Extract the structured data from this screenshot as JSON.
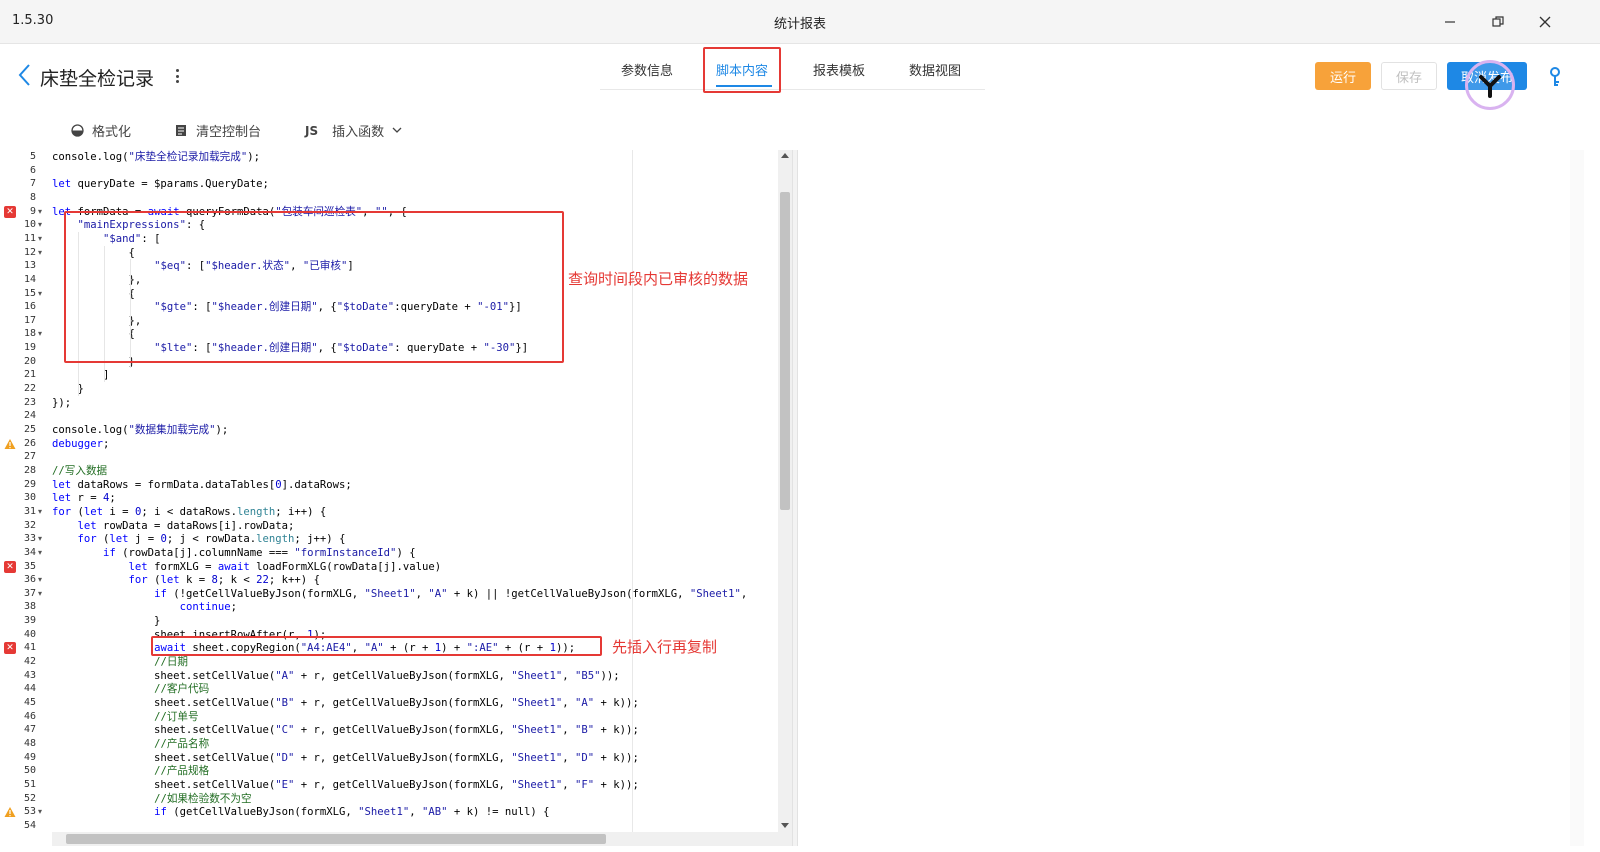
{
  "window": {
    "version": "1.5.30",
    "title": "统计报表"
  },
  "header": {
    "page_title": "床垫全检记录",
    "tabs": [
      {
        "label": "参数信息",
        "active": false
      },
      {
        "label": "脚本内容",
        "active": true
      },
      {
        "label": "报表模板",
        "active": false
      },
      {
        "label": "数据视图",
        "active": false
      }
    ],
    "buttons": {
      "run": "运行",
      "save": "保存",
      "publish": "取消发布"
    }
  },
  "toolbar": {
    "format": "格式化",
    "clear_console": "清空控制台",
    "js_badge": "JS",
    "insert_function": "插入函数"
  },
  "editor": {
    "lines": [
      {
        "n": 5,
        "text": "console.log(\"床垫全检记录加载完成\");"
      },
      {
        "n": 6,
        "text": ""
      },
      {
        "n": 7,
        "text": "let queryDate = $params.QueryDate;"
      },
      {
        "n": 8,
        "text": ""
      },
      {
        "n": 9,
        "text": "let formData = await queryFormData(\"包装车间巡检表\", \"\", {",
        "marker": "error",
        "fold": true
      },
      {
        "n": 10,
        "text": "    \"mainExpressions\": {",
        "fold": true
      },
      {
        "n": 11,
        "text": "        \"$and\": [",
        "fold": true
      },
      {
        "n": 12,
        "text": "            {",
        "fold": true
      },
      {
        "n": 13,
        "text": "                \"$eq\": [\"$header.状态\", \"已审核\"]"
      },
      {
        "n": 14,
        "text": "            },"
      },
      {
        "n": 15,
        "text": "            {",
        "fold": true
      },
      {
        "n": 16,
        "text": "                \"$gte\": [\"$header.创建日期\", {\"$toDate\":queryDate + \"-01\"}]"
      },
      {
        "n": 17,
        "text": "            },"
      },
      {
        "n": 18,
        "text": "            {",
        "fold": true
      },
      {
        "n": 19,
        "text": "                \"$lte\": [\"$header.创建日期\", {\"$toDate\": queryDate + \"-30\"}]"
      },
      {
        "n": 20,
        "text": "            }"
      },
      {
        "n": 21,
        "text": "        ]"
      },
      {
        "n": 22,
        "text": "    }"
      },
      {
        "n": 23,
        "text": "});"
      },
      {
        "n": 24,
        "text": ""
      },
      {
        "n": 25,
        "text": "console.log(\"数据集加载完成\");"
      },
      {
        "n": 26,
        "text": "debugger;",
        "marker": "warning"
      },
      {
        "n": 27,
        "text": ""
      },
      {
        "n": 28,
        "text": "//写入数据"
      },
      {
        "n": 29,
        "text": "let dataRows = formData.dataTables[0].dataRows;"
      },
      {
        "n": 30,
        "text": "let r = 4;"
      },
      {
        "n": 31,
        "text": "for (let i = 0; i < dataRows.length; i++) {",
        "fold": true
      },
      {
        "n": 32,
        "text": "    let rowData = dataRows[i].rowData;"
      },
      {
        "n": 33,
        "text": "    for (let j = 0; j < rowData.length; j++) {",
        "fold": true
      },
      {
        "n": 34,
        "text": "        if (rowData[j].columnName === \"formInstanceId\") {",
        "fold": true
      },
      {
        "n": 35,
        "text": "            let formXLG = await loadFormXLG(rowData[j].value)",
        "marker": "error"
      },
      {
        "n": 36,
        "text": "            for (let k = 8; k < 22; k++) {",
        "fold": true
      },
      {
        "n": 37,
        "text": "                if (!getCellValueByJson(formXLG, \"Sheet1\", \"A\" + k) || !getCellValueByJson(formXLG, \"Sheet1\",",
        "fold": true
      },
      {
        "n": 38,
        "text": "                    continue;"
      },
      {
        "n": 39,
        "text": "                }"
      },
      {
        "n": 40,
        "text": "                sheet.insertRowAfter(r, 1);"
      },
      {
        "n": 41,
        "text": "                await sheet.copyRegion(\"A4:AE4\", \"A\" + (r + 1) + \":AE\" + (r + 1));",
        "marker": "error"
      },
      {
        "n": 42,
        "text": "                //日期"
      },
      {
        "n": 43,
        "text": "                sheet.setCellValue(\"A\" + r, getCellValueByJson(formXLG, \"Sheet1\", \"B5\"));"
      },
      {
        "n": 44,
        "text": "                //客户代码"
      },
      {
        "n": 45,
        "text": "                sheet.setCellValue(\"B\" + r, getCellValueByJson(formXLG, \"Sheet1\", \"A\" + k));"
      },
      {
        "n": 46,
        "text": "                //订单号"
      },
      {
        "n": 47,
        "text": "                sheet.setCellValue(\"C\" + r, getCellValueByJson(formXLG, \"Sheet1\", \"B\" + k));"
      },
      {
        "n": 48,
        "text": "                //产品名称"
      },
      {
        "n": 49,
        "text": "                sheet.setCellValue(\"D\" + r, getCellValueByJson(formXLG, \"Sheet1\", \"D\" + k));"
      },
      {
        "n": 50,
        "text": "                //产品规格"
      },
      {
        "n": 51,
        "text": "                sheet.setCellValue(\"E\" + r, getCellValueByJson(formXLG, \"Sheet1\", \"F\" + k));"
      },
      {
        "n": 52,
        "text": "                //如果检验数不为空"
      },
      {
        "n": 53,
        "text": "                if (getCellValueByJson(formXLG, \"Sheet1\", \"AB\" + k) != null) {",
        "marker": "warning",
        "fold": true
      },
      {
        "n": 54,
        "text": ""
      }
    ]
  },
  "annotations": {
    "query_note": "查询时间段内已审核的数据",
    "insert_note": "先插入行再复制"
  },
  "colors": {
    "accent": "#1e88e5",
    "run": "#f7a23a",
    "annotation": "#e53935"
  }
}
